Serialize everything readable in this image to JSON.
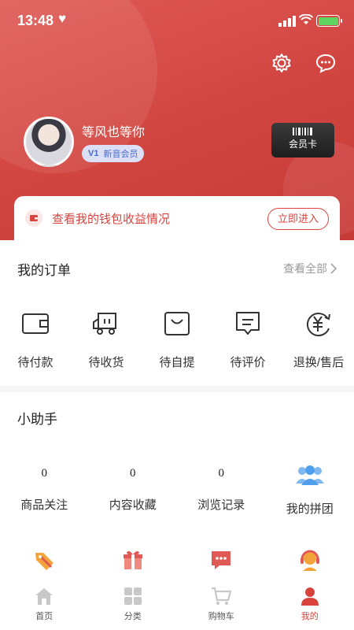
{
  "status_bar": {
    "time": "13:48"
  },
  "profile": {
    "nickname": "等风也等你",
    "level": "V1",
    "member_tier": "新音会员",
    "vip_card_label": "会员卡"
  },
  "wallet": {
    "text": "查看我的钱包收益情况",
    "button": "立即进入"
  },
  "orders": {
    "title": "我的订单",
    "view_all": "查看全部",
    "items": [
      {
        "label": "待付款",
        "icon": "wallet-icon"
      },
      {
        "label": "待收货",
        "icon": "truck-icon"
      },
      {
        "label": "待自提",
        "icon": "bag-icon"
      },
      {
        "label": "待评价",
        "icon": "comment-icon"
      },
      {
        "label": "退换/售后",
        "icon": "yen-refresh-icon"
      }
    ]
  },
  "helper": {
    "title": "小助手",
    "stats": [
      {
        "value": "0",
        "label": "商品关注"
      },
      {
        "value": "0",
        "label": "内容收藏"
      },
      {
        "value": "0",
        "label": "浏览记录"
      },
      {
        "value": "",
        "label": "我的拼团",
        "icon": "group-icon"
      }
    ],
    "more_icons": [
      "coupon-icon",
      "gift-icon",
      "message-icon",
      "customer-service-icon"
    ]
  },
  "tabbar": {
    "items": [
      {
        "label": "首页",
        "icon": "home-icon",
        "active": false
      },
      {
        "label": "分类",
        "icon": "category-icon",
        "active": false
      },
      {
        "label": "购物车",
        "icon": "cart-icon",
        "active": false
      },
      {
        "label": "我的",
        "icon": "user-icon",
        "active": true
      }
    ]
  },
  "colors": {
    "brand": "#d9433d",
    "inactive": "#c8c8c8",
    "accent_blue": "#5aa6f0"
  }
}
